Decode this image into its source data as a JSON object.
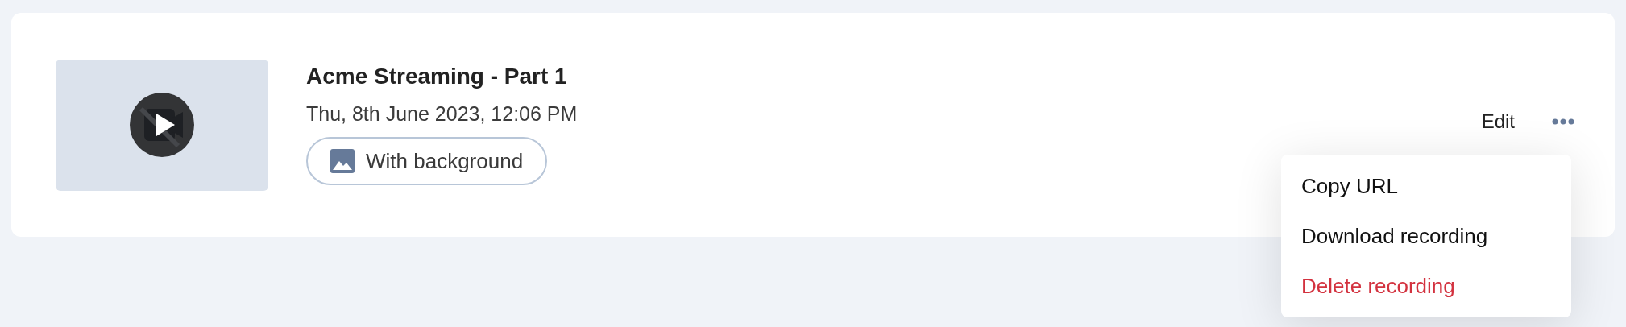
{
  "recording": {
    "title": "Acme Streaming - Part 1",
    "date": "Thu, 8th June 2023, 12:06 PM",
    "tag": "With background"
  },
  "actions": {
    "edit": "Edit"
  },
  "menu": [
    {
      "label": "Copy URL",
      "kind": "normal"
    },
    {
      "label": "Download recording",
      "kind": "normal"
    },
    {
      "label": "Delete recording",
      "kind": "danger"
    }
  ]
}
